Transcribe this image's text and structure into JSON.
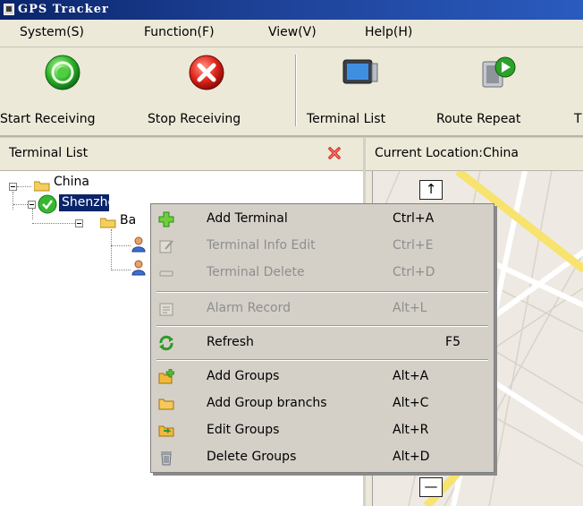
{
  "window": {
    "title": "GPS Tracker"
  },
  "menu": [
    "System(S)",
    "Function(F)",
    "View(V)",
    "Help(H)"
  ],
  "toolbar": {
    "start": "Start Receiving",
    "stop": "Stop Receiving",
    "terminal_list": "Terminal List",
    "route_repeat": "Route Repeat",
    "cut": "T"
  },
  "left_panel": {
    "title": "Terminal List"
  },
  "tree": {
    "root": "China",
    "city": "Shenzhen",
    "group": "Ba"
  },
  "right_panel": {
    "title": "Current Location:China"
  },
  "context_menu": [
    {
      "label": "Add Terminal",
      "shortcut": "Ctrl+A",
      "icon": "add-terminal-icon",
      "enabled": true
    },
    {
      "label": "Terminal Info Edit",
      "shortcut": "Ctrl+E",
      "icon": "edit-icon",
      "enabled": false
    },
    {
      "label": "Terminal Delete",
      "shortcut": "Ctrl+D",
      "icon": "delete-icon",
      "enabled": false
    },
    {
      "label": "Alarm Record",
      "shortcut": "Alt+L",
      "icon": "alarm-record-icon",
      "enabled": false
    },
    {
      "label": "Refresh",
      "shortcut": "F5",
      "icon": "refresh-icon",
      "enabled": true
    },
    {
      "label": "Add Groups",
      "shortcut": "Alt+A",
      "icon": "add-group-icon",
      "enabled": true
    },
    {
      "label": "Add Group branchs",
      "shortcut": "Alt+C",
      "icon": "folder-icon",
      "enabled": true
    },
    {
      "label": "Edit Groups",
      "shortcut": "Alt+R",
      "icon": "edit-group-icon",
      "enabled": true
    },
    {
      "label": "Delete Groups",
      "shortcut": "Alt+D",
      "icon": "trash-icon",
      "enabled": true
    }
  ]
}
